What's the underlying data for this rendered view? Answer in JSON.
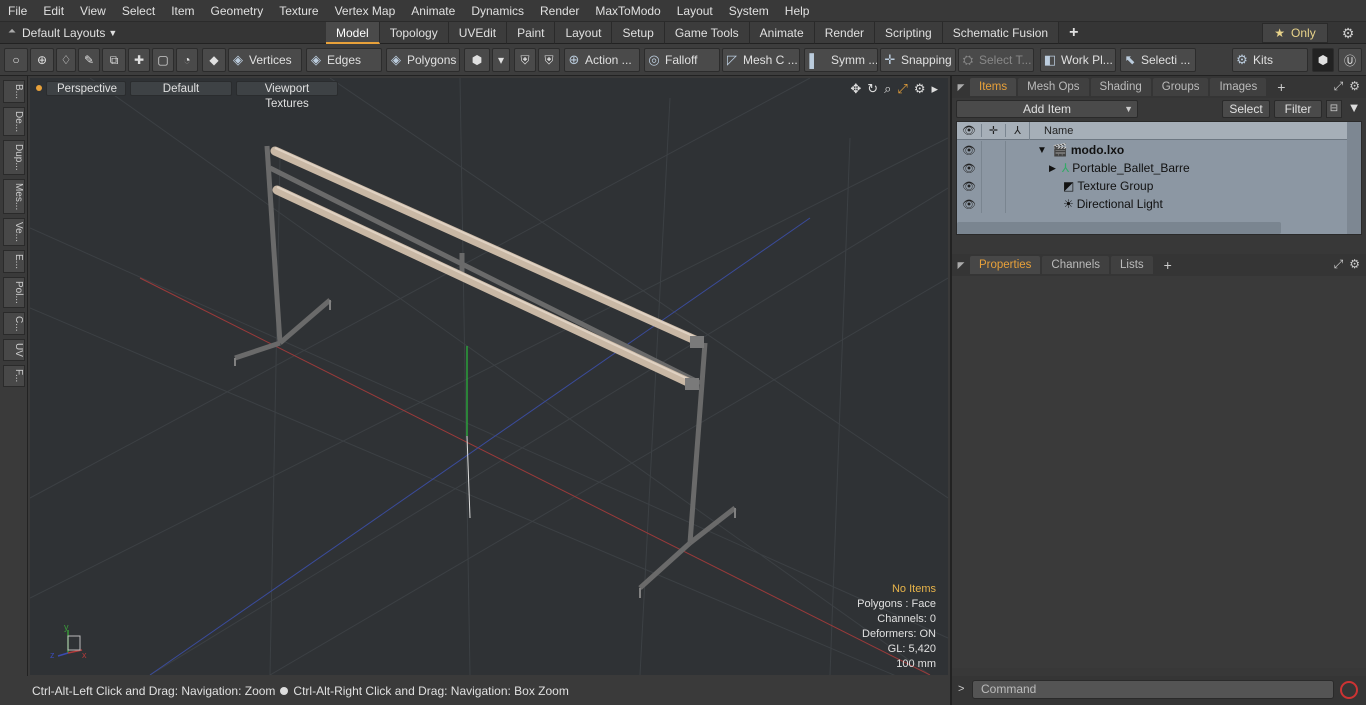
{
  "menu": [
    "File",
    "Edit",
    "View",
    "Select",
    "Item",
    "Geometry",
    "Texture",
    "Vertex Map",
    "Animate",
    "Dynamics",
    "Render",
    "MaxToModo",
    "Layout",
    "System",
    "Help"
  ],
  "layout_dropdown": "Default Layouts",
  "tabs": [
    {
      "label": "Model",
      "active": true
    },
    {
      "label": "Topology"
    },
    {
      "label": "UVEdit"
    },
    {
      "label": "Paint"
    },
    {
      "label": "Layout"
    },
    {
      "label": "Setup"
    },
    {
      "label": "Game Tools"
    },
    {
      "label": "Animate"
    },
    {
      "label": "Render"
    },
    {
      "label": "Scripting"
    },
    {
      "label": "Schematic Fusion"
    },
    {
      "label": "+"
    }
  ],
  "only_label": "Only",
  "toolbar": {
    "vertices": "Vertices",
    "edges": "Edges",
    "polygons": "Polygons",
    "action": "Action ...",
    "falloff": "Falloff",
    "mesh": "Mesh C ...",
    "symm": "Symm ...",
    "snapping": "Snapping",
    "select_t": "Select T...",
    "workpl": "Work Pl...",
    "selecti": "Selecti ...",
    "kits": "Kits"
  },
  "left_tools": [
    "B...",
    "De...",
    "Dup...",
    "Mes...",
    "Ve...",
    "E...",
    "Pol...",
    "C...",
    "UV",
    "F..."
  ],
  "viewport": {
    "view": "Perspective",
    "shading": "Default",
    "textures": "Viewport Textures",
    "info": {
      "selection": "No Items",
      "polygons": "Polygons : Face",
      "channels": "Channels: 0",
      "deformers": "Deformers: ON",
      "gl": "GL: 5,420",
      "unit": "100 mm"
    }
  },
  "status_left": "Ctrl-Alt-Left Click and Drag: Navigation: Zoom",
  "status_right": "Ctrl-Alt-Right Click and Drag: Navigation: Box Zoom",
  "items_panel": {
    "tabs": [
      "Items",
      "Mesh Ops",
      "Shading",
      "Groups",
      "Images",
      "+"
    ],
    "add_item": "Add Item",
    "select": "Select",
    "filter": "Filter",
    "name_header": "Name",
    "rows": [
      {
        "label": "modo.lxo",
        "indent": 0
      },
      {
        "label": "Portable_Ballet_Barre",
        "indent": 1
      },
      {
        "label": "Texture Group",
        "indent": 1
      },
      {
        "label": "Directional Light",
        "indent": 1
      }
    ]
  },
  "props_panel": {
    "tabs": [
      "Properties",
      "Channels",
      "Lists",
      "+"
    ]
  },
  "command_placeholder": "Command",
  "colors": {
    "accent": "#e8a13a",
    "viewport_bg": "#2f3235",
    "tree_bg": "#8c97a3"
  }
}
